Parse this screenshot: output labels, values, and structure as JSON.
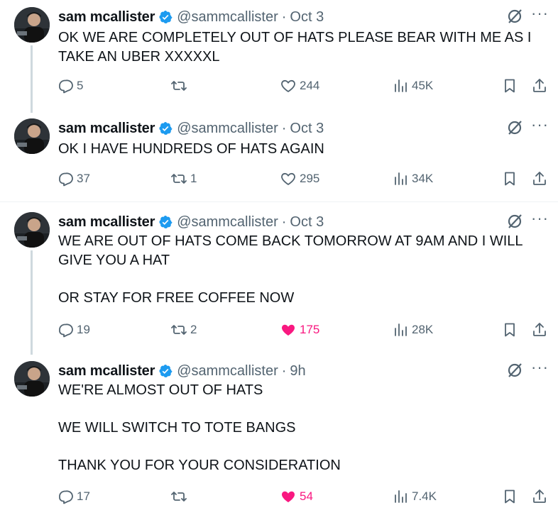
{
  "tweets": [
    {
      "author": "sam mcallister",
      "handle": "@sammcallister",
      "sep": "·",
      "time": "Oct 3",
      "text": "OK WE ARE COMPLETELY OUT OF HATS PLEASE BEAR WITH ME AS I TAKE AN UBER XXXXXL",
      "replies": "5",
      "retweets": "",
      "likes": "244",
      "liked": false,
      "views": "45K"
    },
    {
      "author": "sam mcallister",
      "handle": "@sammcallister",
      "sep": "·",
      "time": "Oct 3",
      "text": "OK I HAVE HUNDREDS OF HATS AGAIN",
      "replies": "37",
      "retweets": "1",
      "likes": "295",
      "liked": false,
      "views": "34K"
    },
    {
      "author": "sam mcallister",
      "handle": "@sammcallister",
      "sep": "·",
      "time": "Oct 3",
      "text": "WE ARE OUT OF HATS COME BACK TOMORROW AT 9AM AND I WILL GIVE YOU A HAT\n\nOR STAY FOR FREE COFFEE NOW",
      "replies": "19",
      "retweets": "2",
      "likes": "175",
      "liked": true,
      "views": "28K"
    },
    {
      "author": "sam mcallister",
      "handle": "@sammcallister",
      "sep": "·",
      "time": "9h",
      "text": "WE'RE ALMOST OUT OF HATS\n\nWE WILL SWITCH TO TOTE BANGS\n\nTHANK YOU FOR YOUR CONSIDERATION",
      "replies": "17",
      "retweets": "",
      "likes": "54",
      "liked": true,
      "views": "7.4K"
    }
  ],
  "more_glyph": "···",
  "icons": {
    "verified": "verified-badge-icon",
    "grok": "grok-icon",
    "reply": "reply-icon",
    "retweet": "retweet-icon",
    "like": "heart-icon",
    "views": "views-icon",
    "bookmark": "bookmark-icon",
    "share": "share-icon"
  },
  "colors": {
    "text": "#0f1419",
    "muted": "#536471",
    "verified": "#1d9bf0",
    "liked": "#f91880",
    "thread_line": "#cfd9de"
  }
}
